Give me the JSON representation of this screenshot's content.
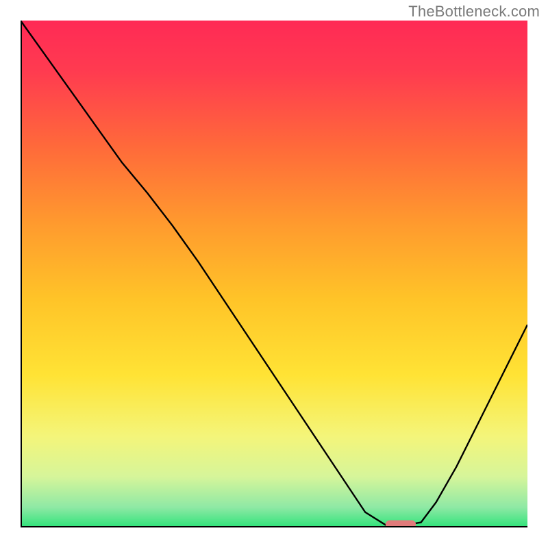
{
  "watermark": "TheBottleneck.com",
  "chart_data": {
    "type": "line",
    "title": "",
    "xlabel": "",
    "ylabel": "",
    "xlim": [
      0,
      100
    ],
    "ylim": [
      0,
      100
    ],
    "grid": false,
    "legend": false,
    "series": [
      {
        "name": "bottleneck-curve",
        "x": [
          0,
          5,
          10,
          15,
          20,
          25,
          30,
          35,
          40,
          45,
          50,
          55,
          60,
          65,
          68,
          72,
          76,
          79,
          82,
          86,
          90,
          95,
          100
        ],
        "y": [
          100,
          93,
          86,
          79,
          72,
          66,
          59.5,
          52.5,
          45,
          37.5,
          30,
          22.5,
          15,
          7.5,
          3,
          0.5,
          0.5,
          1,
          5,
          12,
          20,
          30,
          40
        ]
      }
    ],
    "marker": {
      "name": "optimal-range",
      "x_start": 72,
      "x_end": 78,
      "y": 0.6,
      "color": "#e17b7b"
    },
    "gradient_stops": [
      {
        "offset": 0.0,
        "color": "#ff2a55"
      },
      {
        "offset": 0.1,
        "color": "#ff3b50"
      },
      {
        "offset": 0.25,
        "color": "#ff6a3a"
      },
      {
        "offset": 0.4,
        "color": "#ff9a2e"
      },
      {
        "offset": 0.55,
        "color": "#ffc428"
      },
      {
        "offset": 0.7,
        "color": "#ffe335"
      },
      {
        "offset": 0.82,
        "color": "#f4f57a"
      },
      {
        "offset": 0.9,
        "color": "#d6f59a"
      },
      {
        "offset": 0.96,
        "color": "#8fe9a5"
      },
      {
        "offset": 1.0,
        "color": "#2fe37a"
      }
    ]
  }
}
